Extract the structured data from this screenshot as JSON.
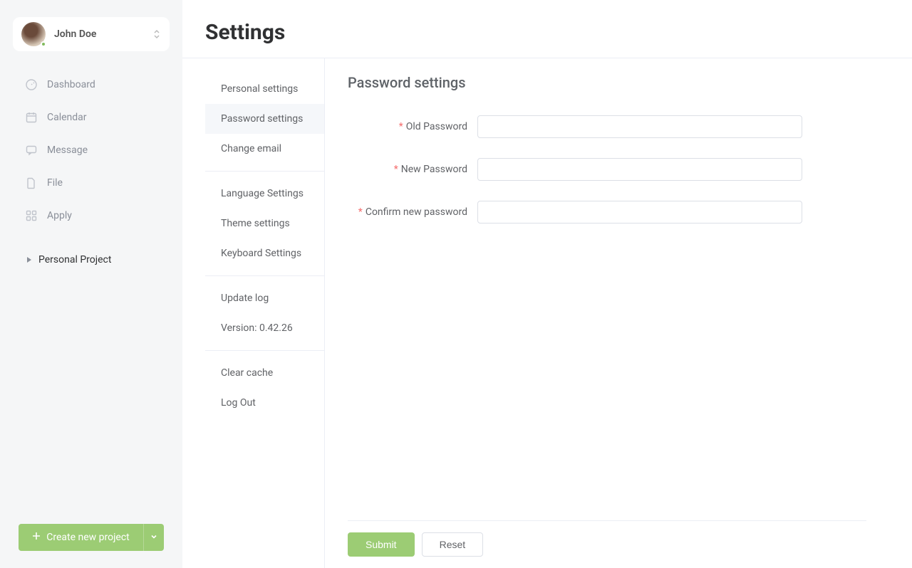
{
  "user": {
    "name": "John Doe"
  },
  "sidebar": {
    "items": [
      {
        "label": "Dashboard",
        "icon": "dashboard"
      },
      {
        "label": "Calendar",
        "icon": "calendar"
      },
      {
        "label": "Message",
        "icon": "message"
      },
      {
        "label": "File",
        "icon": "file"
      },
      {
        "label": "Apply",
        "icon": "apply"
      }
    ],
    "project_section_label": "Personal Project",
    "create_button_label": "Create new project"
  },
  "page": {
    "title": "Settings"
  },
  "settings_nav": {
    "groups": [
      [
        {
          "label": "Personal settings",
          "active": false
        },
        {
          "label": "Password settings",
          "active": true
        },
        {
          "label": "Change email",
          "active": false
        }
      ],
      [
        {
          "label": "Language Settings"
        },
        {
          "label": "Theme settings"
        },
        {
          "label": "Keyboard Settings"
        }
      ],
      [
        {
          "label": "Update log"
        },
        {
          "label": "Version: 0.42.26",
          "static": true
        }
      ],
      [
        {
          "label": "Clear cache"
        },
        {
          "label": "Log Out"
        }
      ]
    ]
  },
  "panel": {
    "title": "Password settings",
    "fields": {
      "old_password_label": "Old Password",
      "new_password_label": "New Password",
      "confirm_password_label": "Confirm new password",
      "old_password_value": "",
      "new_password_value": "",
      "confirm_password_value": ""
    },
    "required_marker": "*",
    "submit_label": "Submit",
    "reset_label": "Reset"
  },
  "colors": {
    "accent": "#9ccc74"
  }
}
